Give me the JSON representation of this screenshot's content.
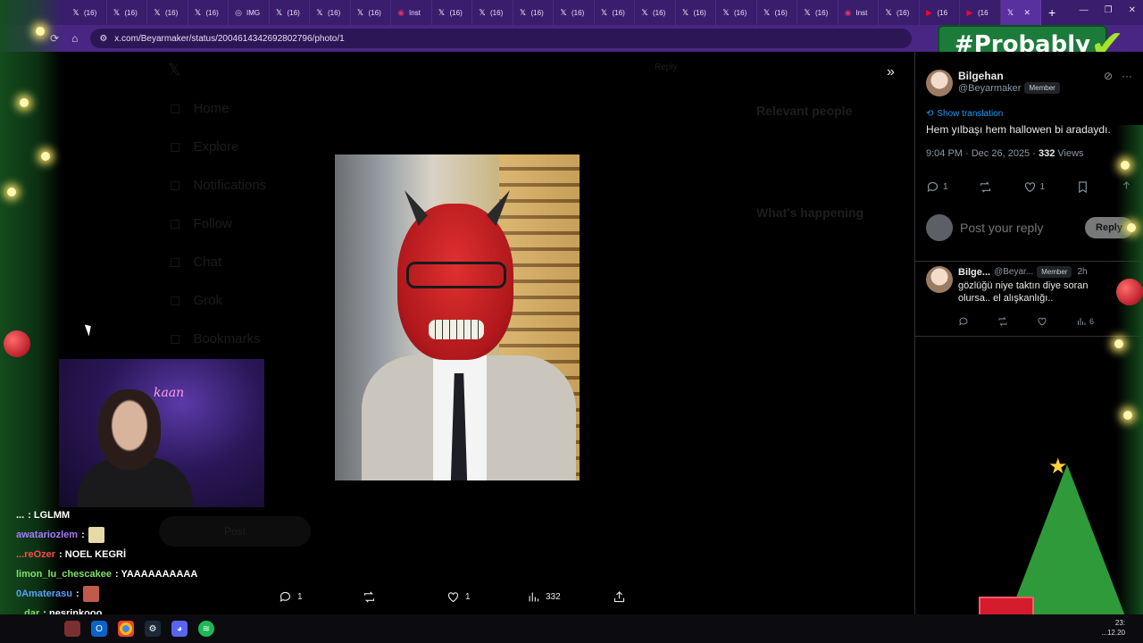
{
  "browser": {
    "tabs": [
      {
        "label": "(16)",
        "favicon": "x-icon"
      },
      {
        "label": "(16)",
        "favicon": "x-icon"
      },
      {
        "label": "(16)",
        "favicon": "x-icon"
      },
      {
        "label": "(16)",
        "favicon": "x-icon"
      },
      {
        "label": "IMG",
        "favicon": "web-icon"
      },
      {
        "label": "(16)",
        "favicon": "x-icon"
      },
      {
        "label": "(16)",
        "favicon": "x-icon"
      },
      {
        "label": "(16)",
        "favicon": "x-icon"
      },
      {
        "label": "Inst",
        "favicon": "instagram-icon"
      },
      {
        "label": "(16)",
        "favicon": "x-icon"
      },
      {
        "label": "(16)",
        "favicon": "x-icon"
      },
      {
        "label": "(16)",
        "favicon": "x-icon"
      },
      {
        "label": "(16)",
        "favicon": "x-icon"
      },
      {
        "label": "(16)",
        "favicon": "x-icon"
      },
      {
        "label": "(16)",
        "favicon": "x-icon"
      },
      {
        "label": "(16)",
        "favicon": "x-icon"
      },
      {
        "label": "(16)",
        "favicon": "x-icon"
      },
      {
        "label": "(16)",
        "favicon": "x-icon"
      },
      {
        "label": "(16)",
        "favicon": "x-icon"
      },
      {
        "label": "Inst",
        "favicon": "instagram-icon"
      },
      {
        "label": "(16)",
        "favicon": "x-icon"
      },
      {
        "label": "(16",
        "favicon": "youtube-icon"
      },
      {
        "label": "(16",
        "favicon": "youtube-icon"
      }
    ],
    "url": "x.com/Beyarmaker/status/2004614342692802796/photo/1"
  },
  "overlay": {
    "hashtag": "#Probably"
  },
  "post": {
    "author_name": "Bilgehan",
    "author_handle": "@Beyarmaker",
    "member_badge": "Member",
    "show_translation": "Show translation",
    "text": "Hem yılbaşı hem hallowen bi aradaydı.",
    "time": "9:04 PM · Dec 26, 2025 · ",
    "views": "332",
    "views_label": " Views",
    "replies": "1",
    "likes": "1",
    "reply_placeholder": "Post your reply",
    "reply_button": "Reply"
  },
  "reply": {
    "author_name": "Bilge...",
    "author_handle": "@Beyar...",
    "member_badge": "Member",
    "time": "2h",
    "text_line1": "gözlüğü niye taktın diye soran",
    "text_line2": "olursa.. el alışkanlığı..",
    "views": "6"
  },
  "media_actions": {
    "replies": "1",
    "likes": "1",
    "views": "332"
  },
  "background_ghost": {
    "nav": [
      "Home",
      "Explore",
      "Notifications",
      "Follow",
      "Chat",
      "Grok",
      "Bookmarks"
    ],
    "relevant_people": "Relevant people",
    "whats_happening": "What's happening",
    "post_button": "Post",
    "reply_label": "Reply"
  },
  "webcam": {
    "neon_text": "kaan"
  },
  "chat": [
    {
      "user": "...",
      "msg": ": LGLMM",
      "color": "#ffffff"
    },
    {
      "user": "awatariozlem",
      "msg": " :",
      "color": "#a77bff",
      "emote": "#e8d9a8"
    },
    {
      "user": "...reOzer",
      "msg": " : NOEL KEGRİ",
      "color": "#ff4a4a"
    },
    {
      "user": "limon_lu_chescakee",
      "msg": " : YAAAAAAAAAA",
      "color": "#7fe06a"
    },
    {
      "user": "0Amaterasu",
      "msg": " :",
      "color": "#5aa0ff",
      "emote": "#c05a4a"
    },
    {
      "user": "...dar",
      "msg": " : nesrinkooo",
      "color": "#7fe06a"
    }
  ],
  "taskbar": {
    "clock_time": "23:",
    "clock_date": "...12.20"
  },
  "colors": {
    "browser_frame": "#3b1d6e",
    "x_blue": "#1d9bf0",
    "overlay_green": "#1c7a3a"
  }
}
